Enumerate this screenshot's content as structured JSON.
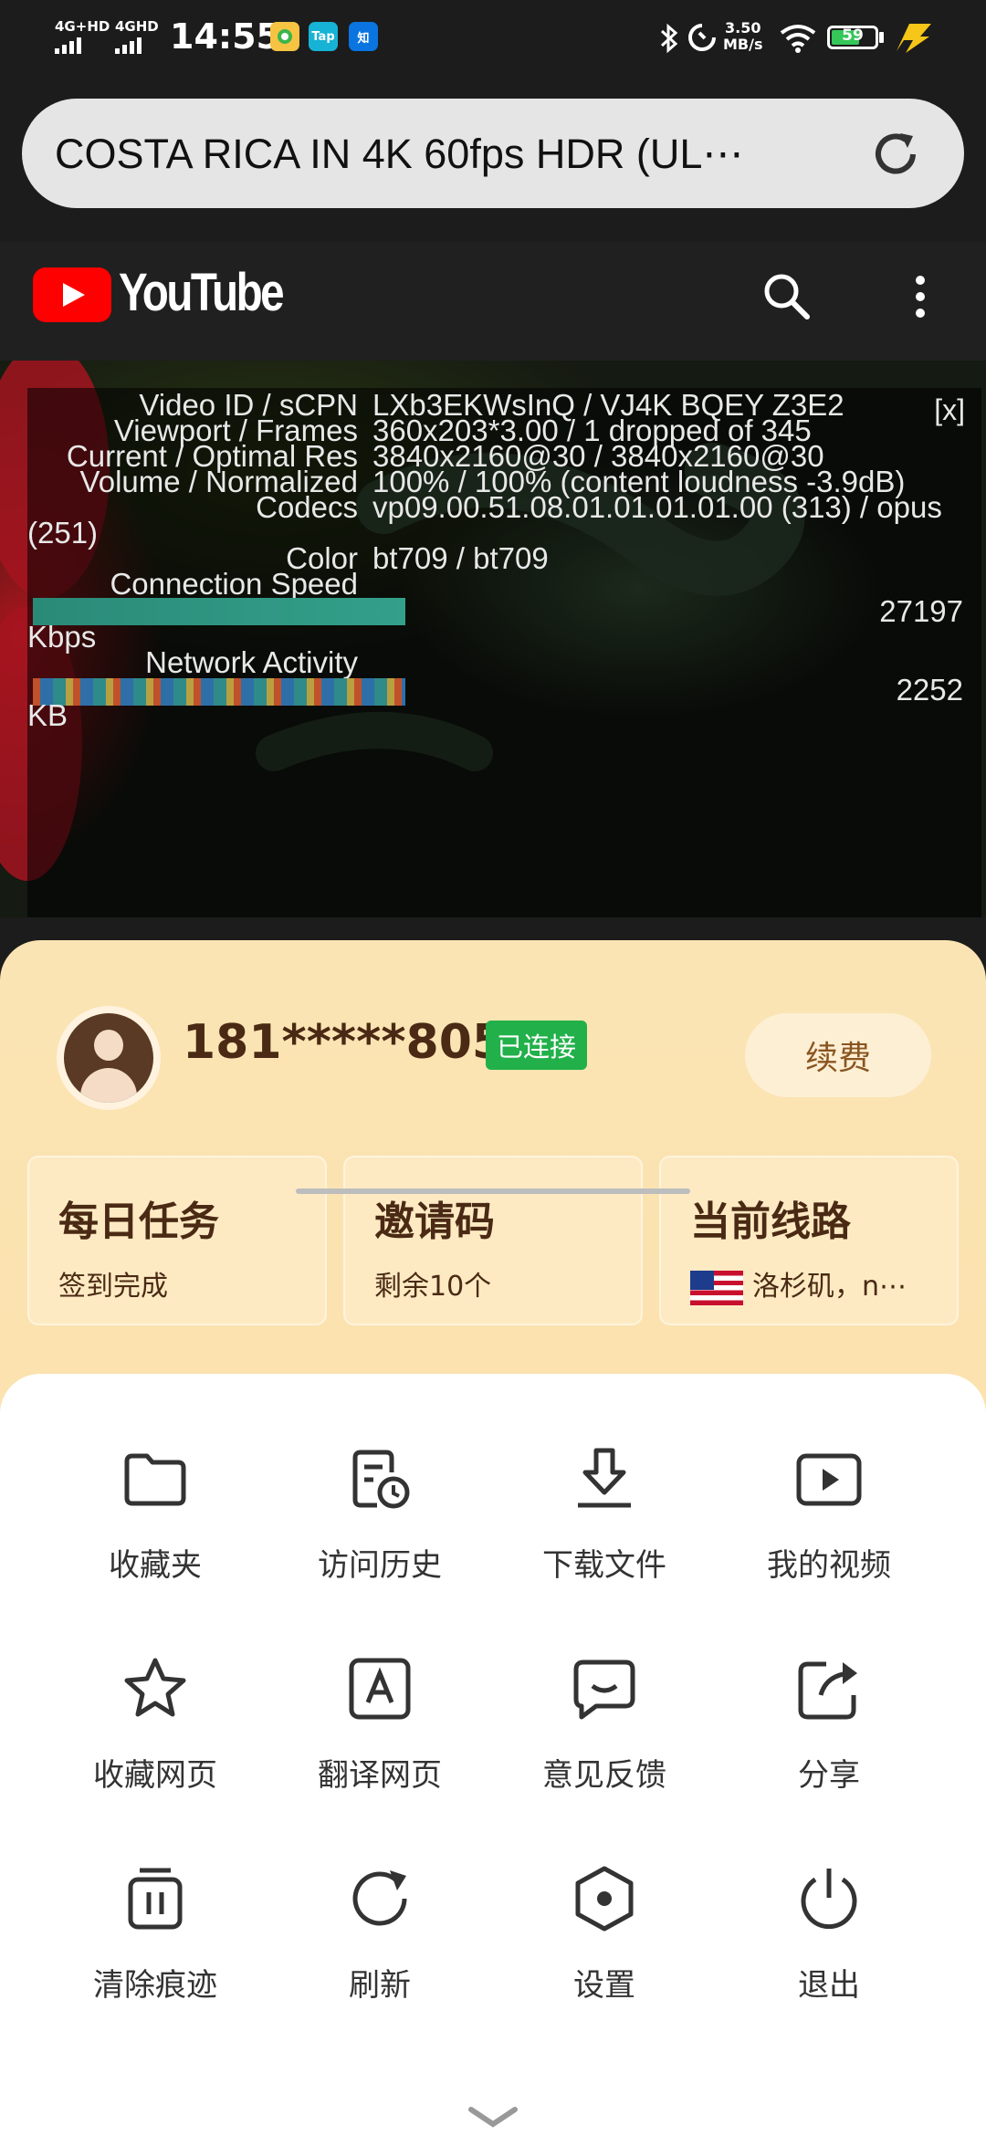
{
  "status_bar": {
    "sim1": "4G+HD",
    "sim2": "4GHD",
    "time": "14:55",
    "app_badges": [
      {
        "label": "",
        "color": "#f6c343",
        "icon": "app-badge-icon"
      },
      {
        "label": "Tap",
        "color": "#17b3d6",
        "icon": "taptap-icon"
      },
      {
        "label": "知",
        "color": "#0a74e0",
        "icon": "zhihu-icon"
      }
    ],
    "net_speed": "3.50",
    "net_unit": "MB/s",
    "battery": "59"
  },
  "browser": {
    "url": "COSTA RICA IN 4K 60fps HDR (UL⋯"
  },
  "youtube": {
    "wordmark": "YouTube"
  },
  "stats": {
    "close": "[x]",
    "rows": [
      {
        "label": "Video ID / sCPN",
        "value": "LXb3EKWsInQ / VJ4K BQEY Z3E2"
      },
      {
        "label": "Viewport / Frames",
        "value": "360x203*3.00 / 1 dropped of 345"
      },
      {
        "label": "Current / Optimal Res",
        "value": "3840x2160@30 / 3840x2160@30"
      },
      {
        "label": "Volume / Normalized",
        "value": "100% / 100% (content loudness -3.9dB)"
      },
      {
        "label": "Codecs",
        "value": "vp09.00.51.08.01.01.01.01.00 (313) / opus"
      }
    ],
    "codecs_wrap": "(251)",
    "color_label": "Color",
    "color_value": "bt709 / bt709",
    "conn_label": "Connection Speed",
    "conn_value": "27197",
    "conn_unit": "Kbps",
    "net_label": "Network Activity",
    "net_value": "2252",
    "net_unit": "KB"
  },
  "account": {
    "phone": "181*****805",
    "status": "已连接",
    "renew": "续费"
  },
  "cards": [
    {
      "title": "每日任务",
      "sub": "签到完成"
    },
    {
      "title": "邀请码",
      "sub": "剩余10个"
    },
    {
      "title": "当前线路",
      "sub": "洛杉矶，n⋯"
    }
  ],
  "menu": [
    {
      "label": "收藏夹",
      "icon": "folder-icon"
    },
    {
      "label": "访问历史",
      "icon": "history-icon"
    },
    {
      "label": "下载文件",
      "icon": "download-icon"
    },
    {
      "label": "我的视频",
      "icon": "video-icon"
    },
    {
      "label": "收藏网页",
      "icon": "star-icon"
    },
    {
      "label": "翻译网页",
      "icon": "translate-icon"
    },
    {
      "label": "意见反馈",
      "icon": "feedback-icon"
    },
    {
      "label": "分享",
      "icon": "share-icon"
    },
    {
      "label": "清除痕迹",
      "icon": "trash-icon"
    },
    {
      "label": "刷新",
      "icon": "refresh-icon"
    },
    {
      "label": "设置",
      "icon": "settings-icon"
    },
    {
      "label": "退出",
      "icon": "power-icon"
    }
  ]
}
